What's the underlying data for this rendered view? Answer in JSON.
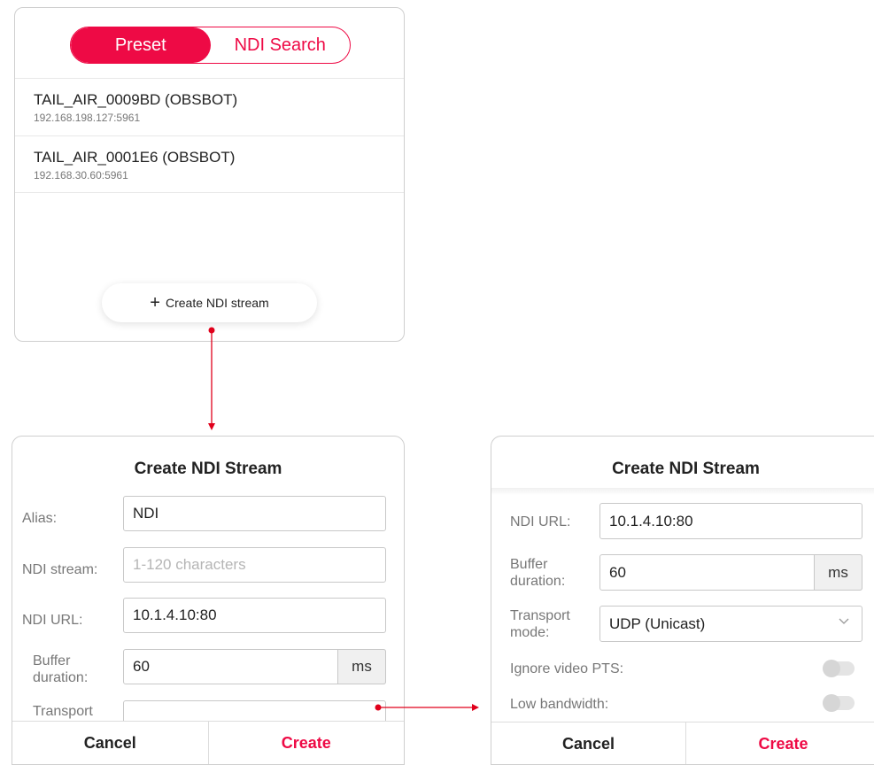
{
  "panel_list": {
    "tabs": [
      {
        "label": "Preset",
        "active": true
      },
      {
        "label": "NDI Search",
        "active": false
      }
    ],
    "devices": [
      {
        "name": "TAIL_AIR_0009BD (OBSBOT)",
        "address": "192.168.198.127:5961"
      },
      {
        "name": "TAIL_AIR_0001E6 (OBSBOT)",
        "address": "192.168.30.60:5961"
      }
    ],
    "create_button": {
      "icon": "plus-icon",
      "icon_glyph": "+",
      "label": "Create NDI stream"
    }
  },
  "dialog_top": {
    "title": "Create NDI Stream",
    "alias_label": "Alias:",
    "alias_value": "NDI",
    "stream_label": "NDI stream:",
    "stream_placeholder": "1-120 characters",
    "url_label": "NDI URL:",
    "url_value": "10.1.4.10:80",
    "buffer_label_1": "Buffer",
    "buffer_label_2": "duration:",
    "buffer_value": "60",
    "buffer_unit": "ms",
    "transport_label_partial": "Transport",
    "cancel_label": "Cancel",
    "create_label": "Create"
  },
  "dialog_scrolled": {
    "title": "Create NDI Stream",
    "url_label": "NDI URL:",
    "url_value": "10.1.4.10:80",
    "buffer_label_1": "Buffer",
    "buffer_label_2": "duration:",
    "buffer_value": "60",
    "buffer_unit": "ms",
    "transport_label_1": "Transport",
    "transport_label_2": "mode:",
    "transport_value": "UDP (Unicast)",
    "ignore_pts_label": "Ignore video PTS:",
    "ignore_pts_on": false,
    "low_bandwidth_label": "Low bandwidth:",
    "low_bandwidth_on": false,
    "cancel_label": "Cancel",
    "create_label": "Create"
  },
  "colors": {
    "accent": "#ee0a45",
    "arrow": "#e0001b"
  }
}
